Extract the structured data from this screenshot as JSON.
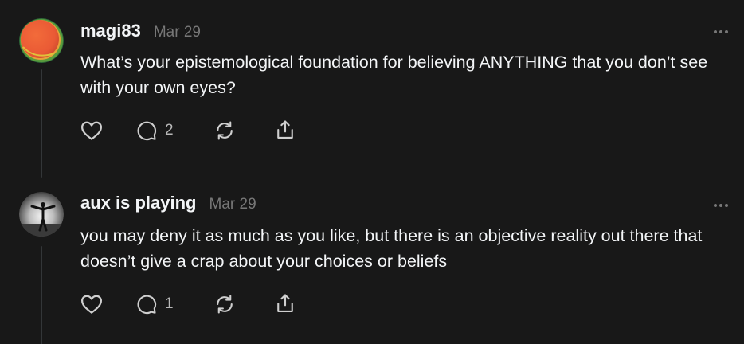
{
  "posts": [
    {
      "username": "magi83",
      "timestamp": "Mar 29",
      "text": "What’s your epistemological foundation for believing ANYTHING that you don’t see with your own eyes?",
      "reply_count": "2",
      "avatar_icon": "gradient-circle-avatar",
      "colors": {
        "avatar_outer": "#e8712f",
        "avatar_ring": "#3f8f3a"
      }
    },
    {
      "username": "aux is playing",
      "timestamp": "Mar 29",
      "text": "you may deny it as much as you like, but there is an objective reality out there that doesn’t give a crap about your choices or beliefs",
      "reply_count": "1",
      "avatar_icon": "silhouette-photo-avatar"
    }
  ],
  "icons": {
    "more": "more-horizontal-icon",
    "like": "heart-icon",
    "reply": "comment-icon",
    "repost": "repost-icon",
    "share": "share-icon"
  },
  "colors": {
    "background": "#181818",
    "text": "#f3f5f7",
    "muted": "#777777",
    "thread_line": "#333638"
  }
}
